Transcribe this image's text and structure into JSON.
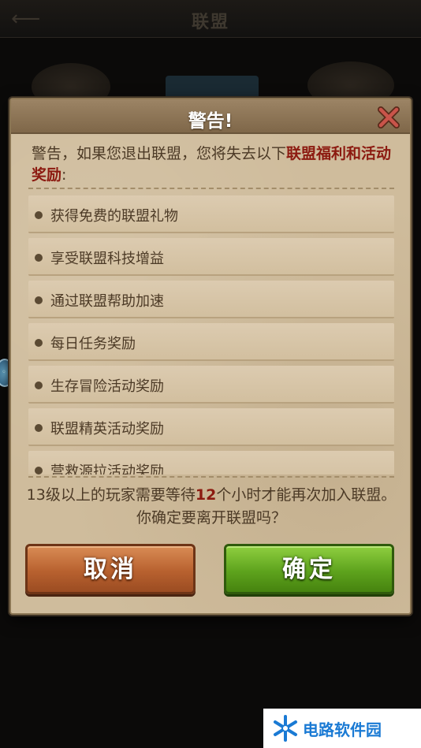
{
  "background": {
    "title": "联盟"
  },
  "dialog": {
    "title": "警告!",
    "intro_text": "警告，如果您退出联盟，您将失去以下",
    "intro_highlight": "联盟福利和活动奖励",
    "intro_end": ":",
    "items": [
      {
        "label": "获得免费的联盟礼物"
      },
      {
        "label": "享受联盟科技增益"
      },
      {
        "label": "通过联盟帮助加速"
      },
      {
        "label": "每日任务奖励"
      },
      {
        "label": "生存冒险活动奖励"
      },
      {
        "label": "联盟精英活动奖励"
      },
      {
        "label": "营救源拉活动奖励"
      }
    ],
    "notice_pre": "13级以上的玩家需要等待",
    "notice_hours": "12",
    "notice_post": "个小时才能再次加入联盟。你确定要离开联盟吗？",
    "cancel_label": "取消",
    "confirm_label": "确定"
  },
  "watermark": {
    "text": "电路软件园"
  },
  "colors": {
    "highlight": "#8c1a10",
    "cancel_button": "#b8612f",
    "confirm_button": "#5ea31d",
    "watermark": "#1a7ad4"
  }
}
